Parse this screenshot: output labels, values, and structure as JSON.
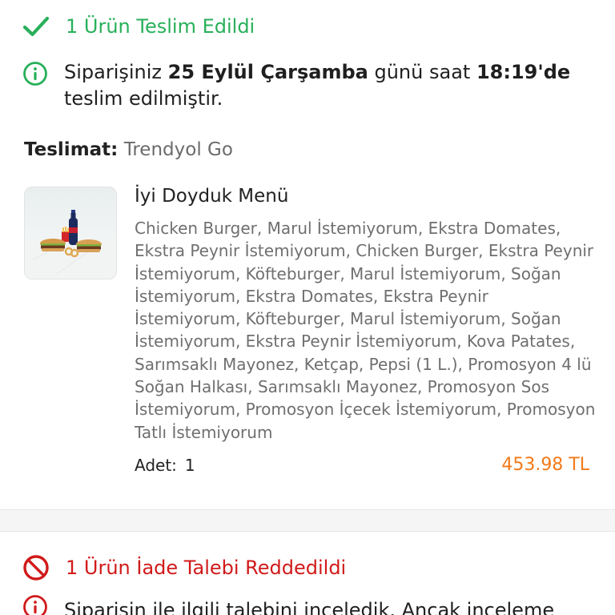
{
  "delivered": {
    "title": "1 Ürün Teslim Edildi",
    "color": "#28b05a",
    "icon": "check-icon"
  },
  "delivery_info": {
    "icon": "info-circle-icon",
    "prefix": "Siparişiniz ",
    "date": "25 Eylül Çarşamba",
    "middle": " günü saat ",
    "time": "18:19'de",
    "suffix": "teslim edilmiştir."
  },
  "delivery": {
    "label": "Teslimat:",
    "value": "Trendyol Go"
  },
  "product": {
    "image_icon": "menu-photo",
    "name": "İyi Doyduk Menü",
    "description": "Chicken Burger, Marul İstemiyorum, Ekstra Domates, Ekstra Peynir İstemiyorum, Chicken Burger, Ekstra Peynir İstemiyorum, Köfteburger, Marul İstemiyorum, Soğan İstemiyorum, Ekstra Domates, Ekstra Peynir İstemiyorum, Köfteburger, Marul İstemiyorum, Soğan İstemiyorum, Ekstra Peynir İstemiyorum, Kova Patates, Sarımsaklı Mayonez, Ketçap, Pepsi (1 L.), Promosyon 4 lü Soğan Halkası, Sarımsaklı Mayonez, Promosyon Sos İstemiyorum, Promosyon İçecek İstemiyorum, Promosyon Tatlı İstemiyorum",
    "qty_label": "Adet:",
    "qty_value": "1",
    "price": "453.98 TL",
    "price_color": "#f27a1a"
  },
  "rejected": {
    "title": "1 Ürün İade Talebi Reddedildi",
    "color": "#d11a1a",
    "icon": "prohibited-icon"
  },
  "rejection_info": {
    "icon": "info-circle-icon",
    "text": "Siparişin ile ilgili talebini inceledik. Ancak inceleme"
  }
}
